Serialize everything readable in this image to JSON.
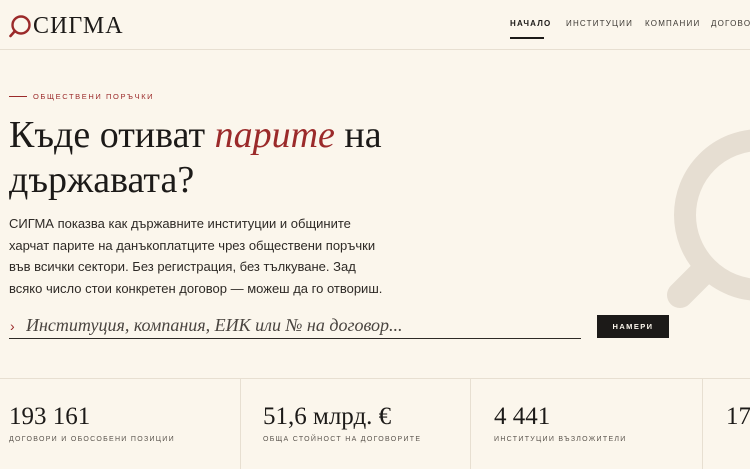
{
  "brand": {
    "name": "СИГМА",
    "accent": "#9b2a2a"
  },
  "nav": {
    "items": [
      {
        "label": "Начало",
        "active": true
      },
      {
        "label": "Институции"
      },
      {
        "label": "Компании"
      },
      {
        "label": "Договори"
      }
    ]
  },
  "hero": {
    "kicker": "Обществени поръчки",
    "headline_pre": "Къде отиват ",
    "headline_em": "парите",
    "headline_post": " на държавата?",
    "intro": "СИГМА показва как държавните институции и общините харчат парите на данъкоплатците чрез обществени поръчки във всички сектори. Без регистрация, без тълкуване. Зад всяко число стои конкретен договор — можеш да го отвориш."
  },
  "search": {
    "placeholder": "Институция, компания, ЕИК или № на договор...",
    "value": "",
    "button_label": "Намери"
  },
  "stats": [
    {
      "value": "193 161",
      "label": "договори и обособени позиции"
    },
    {
      "value": "51,6 млрд. €",
      "label": "обща стойност на договорите"
    },
    {
      "value": "4 441",
      "label": "институции възложители"
    },
    {
      "value": "17",
      "label": ""
    }
  ]
}
